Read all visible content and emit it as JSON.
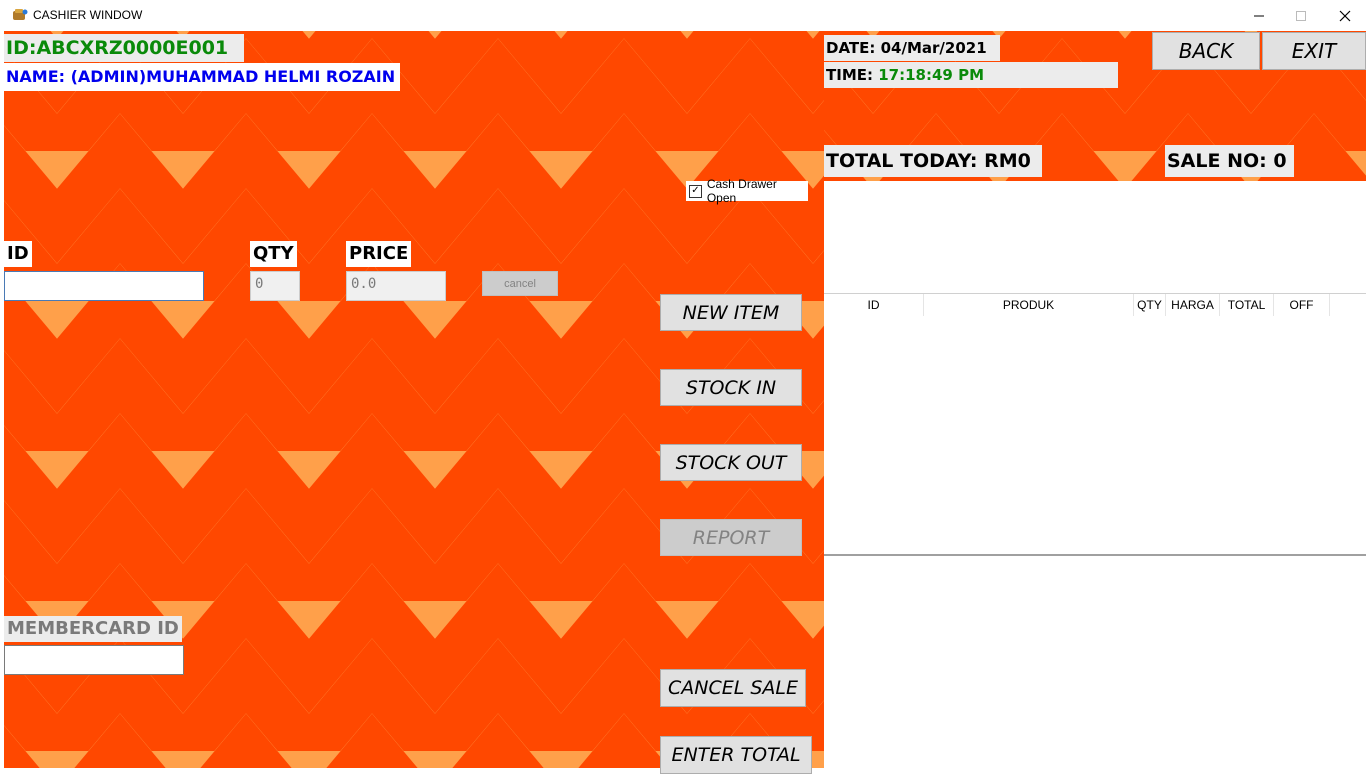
{
  "window": {
    "title": "CASHIER WINDOW",
    "controls": {
      "minimize": "—",
      "maximize": "☐",
      "close": "✕"
    }
  },
  "header": {
    "user_id": "ID:ABCXRZ0000E001",
    "user_name": "NAME: (ADMIN)MUHAMMAD HELMI ROZAIN",
    "date_label": "DATE:",
    "date_value": "04/Mar/2021",
    "time_label": "TIME:",
    "time_value": "17:18:49 PM",
    "back_label": "BACK",
    "exit_label": "EXIT"
  },
  "summary": {
    "total_today": "TOTAL TODAY: RM0",
    "sale_no": "SALE NO: 0",
    "cash_drawer_label": "Cash Drawer Open",
    "cash_drawer_checked": true
  },
  "entry": {
    "id_label": "ID",
    "id_value": "",
    "qty_label": "QTY",
    "qty_value": "0",
    "price_label": "PRICE",
    "price_value": "0.0",
    "cancel_label": "cancel",
    "membercard_label": "MEMBERCARD ID",
    "membercard_value": ""
  },
  "actions": {
    "new_item": "NEW ITEM",
    "stock_in": "STOCK IN",
    "stock_out": "STOCK OUT",
    "report": "REPORT",
    "cancel_sale": "CANCEL SALE",
    "enter_total": "ENTER TOTAL"
  },
  "table": {
    "columns": [
      "ID",
      "PRODUK",
      "QTY",
      "HARGA",
      "TOTAL",
      "OFF"
    ],
    "rows": []
  },
  "colors": {
    "chevron_dark": "#ff4800",
    "chevron_light": "#ffa04a",
    "id_green": "#0a8a0a",
    "name_blue": "#0000ee",
    "time_green": "#0a8a0a",
    "membercard_gray": "#7a7a7a"
  }
}
